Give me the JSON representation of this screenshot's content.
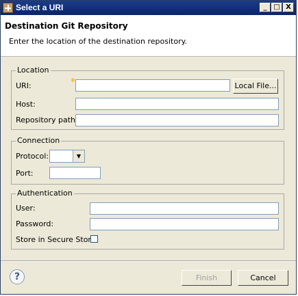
{
  "window": {
    "title": "Select a URI",
    "minimize": "_",
    "maximize": "□",
    "close": "X"
  },
  "header": {
    "title": "Destination Git Repository",
    "description": "Enter the location of the destination repository."
  },
  "location": {
    "legend": "Location",
    "uri_label": "URI:",
    "uri_value": "",
    "local_file_button": "Local File...",
    "host_label": "Host:",
    "host_value": "",
    "path_label": "Repository path:",
    "path_value": ""
  },
  "connection": {
    "legend": "Connection",
    "protocol_label": "Protocol:",
    "protocol_value": "",
    "port_label": "Port:",
    "port_value": ""
  },
  "authentication": {
    "legend": "Authentication",
    "user_label": "User:",
    "user_value": "",
    "password_label": "Password:",
    "password_value": "",
    "store_label": "Store in Secure Store",
    "store_checked": false
  },
  "footer": {
    "help": "?",
    "finish": "Finish",
    "cancel": "Cancel"
  }
}
